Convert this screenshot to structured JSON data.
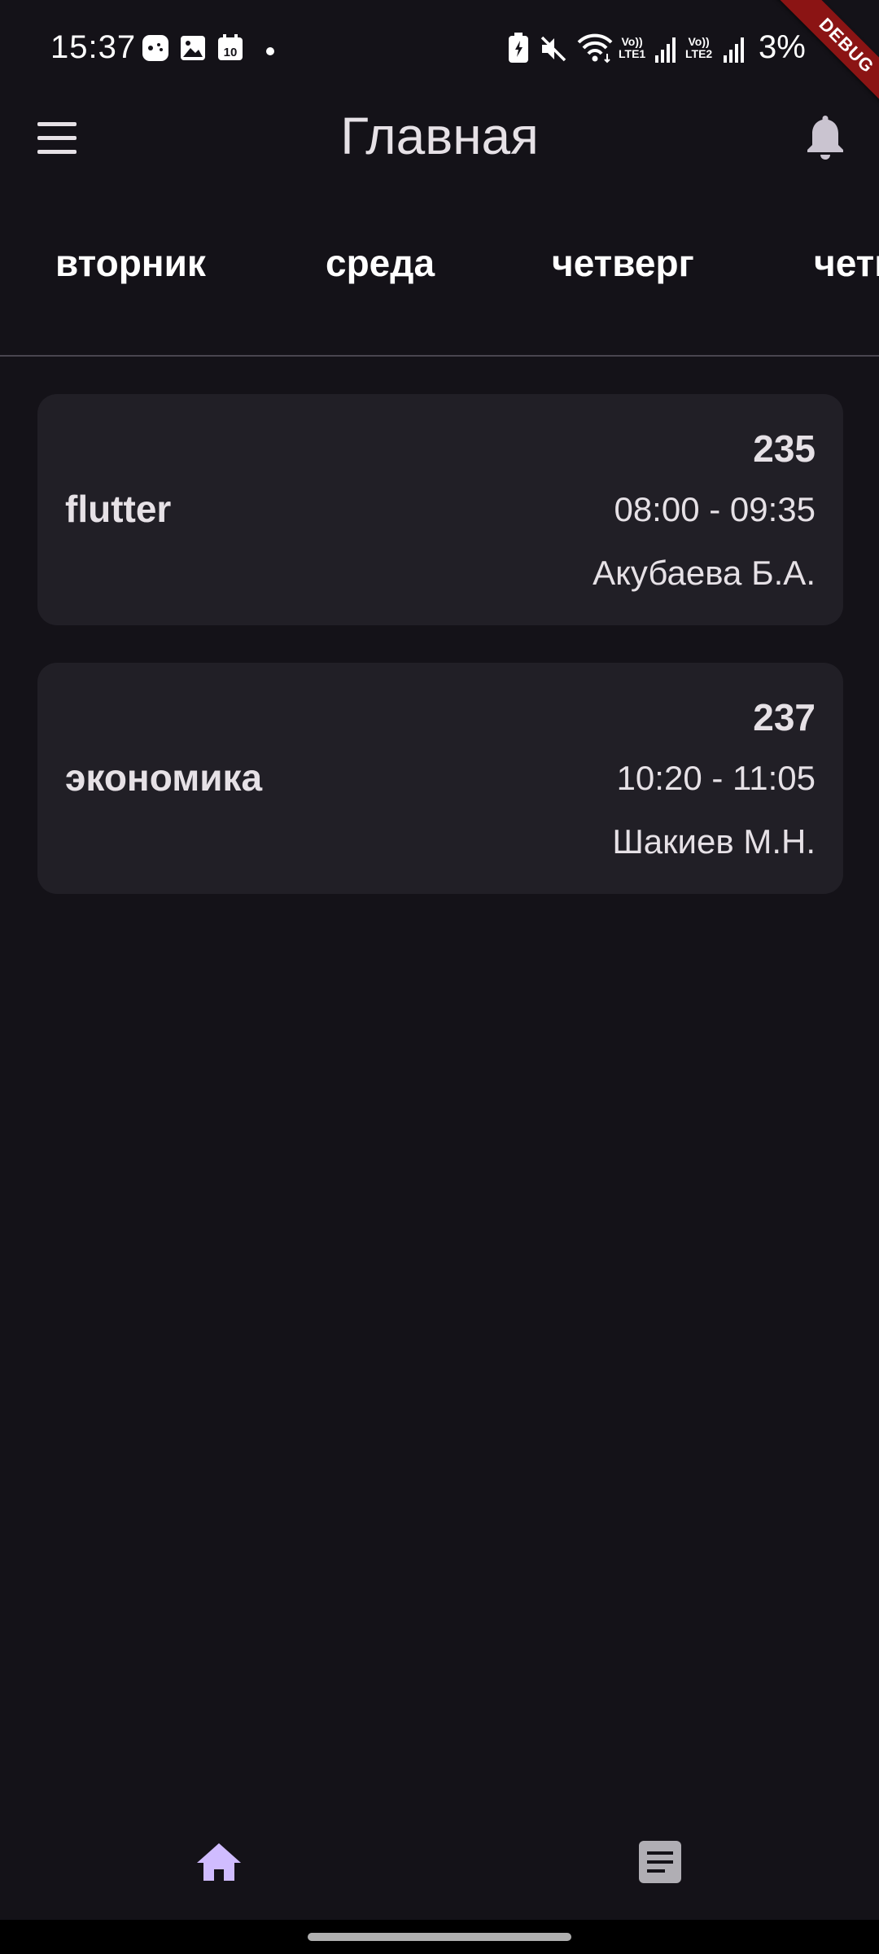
{
  "status_bar": {
    "time": "15:37",
    "battery": "3%",
    "sim1_label": "Vo))\nLTE1",
    "sim2_label": "Vo))\nLTE2",
    "calendar_day": "10"
  },
  "debug_banner": "DEBUG",
  "app_bar": {
    "title": "Главная"
  },
  "days": [
    {
      "label": "вторник"
    },
    {
      "label": "среда"
    },
    {
      "label": "четверг"
    },
    {
      "label": "четверг"
    }
  ],
  "lessons": [
    {
      "name": "flutter",
      "room": "235",
      "time": "08:00 - 09:35",
      "teacher": "Акубаева Б.А."
    },
    {
      "name": "экономика",
      "room": "237",
      "time": "10:20 - 11:05",
      "teacher": "Шакиев М.Н."
    }
  ],
  "bottom_nav": {
    "items": [
      {
        "icon": "home-icon",
        "active": true
      },
      {
        "icon": "article-icon",
        "active": false
      }
    ],
    "active_color": "#d0bcff",
    "inactive_color": "#b0aeb4"
  },
  "colors": {
    "background": "#141218",
    "card": "#211f26",
    "text": "#e6e1e6",
    "debug": "#8b1414"
  }
}
